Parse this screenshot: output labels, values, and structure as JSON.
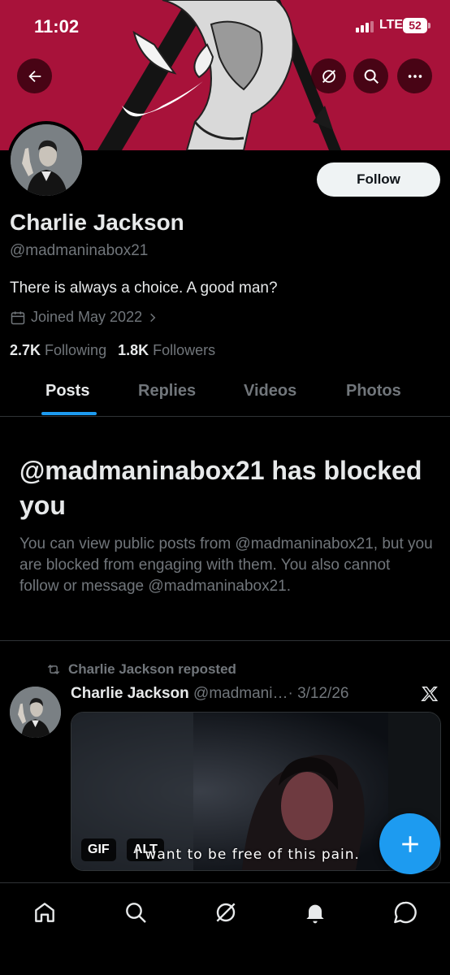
{
  "status_bar": {
    "time": "11:02",
    "network": "LTE",
    "battery": "52"
  },
  "profile": {
    "name": "Charlie Jackson",
    "handle": "@madmaninabox21",
    "bio": "There is always a choice. A good man?",
    "joined": "Joined May 2022",
    "following_count": "2.7K",
    "following_label": "Following",
    "followers_count": "1.8K",
    "followers_label": "Followers",
    "follow_button": "Follow"
  },
  "tabs": [
    {
      "label": "Posts",
      "active": true
    },
    {
      "label": "Replies",
      "active": false
    },
    {
      "label": "Videos",
      "active": false
    },
    {
      "label": "Photos",
      "active": false
    }
  ],
  "blocked_notice": {
    "title": "@madmaninabox21 has blocked you",
    "description": "You can view public posts from @madmaninabox21, but you are blocked from engaging with them. You also cannot follow or message @madmaninabox21."
  },
  "post": {
    "repost_label": "Charlie Jackson reposted",
    "author_name": "Charlie Jackson",
    "author_handle": "@madmani…",
    "separator": "·",
    "date": "3/12/26",
    "media_caption": "I want to be free of this pain.",
    "media_badges": [
      "GIF",
      "ALT"
    ]
  },
  "colors": {
    "banner": "#a8123a",
    "accent": "#1d9bf0",
    "background": "#000000",
    "secondary_text": "#71767b"
  },
  "icons": {
    "header": [
      "back-arrow-icon",
      "grok-icon",
      "search-icon",
      "more-icon"
    ],
    "bottom_nav": [
      "home-icon",
      "search-icon",
      "grok-icon",
      "notifications-bell-icon",
      "messages-icon"
    ],
    "fab": "plus-icon"
  }
}
